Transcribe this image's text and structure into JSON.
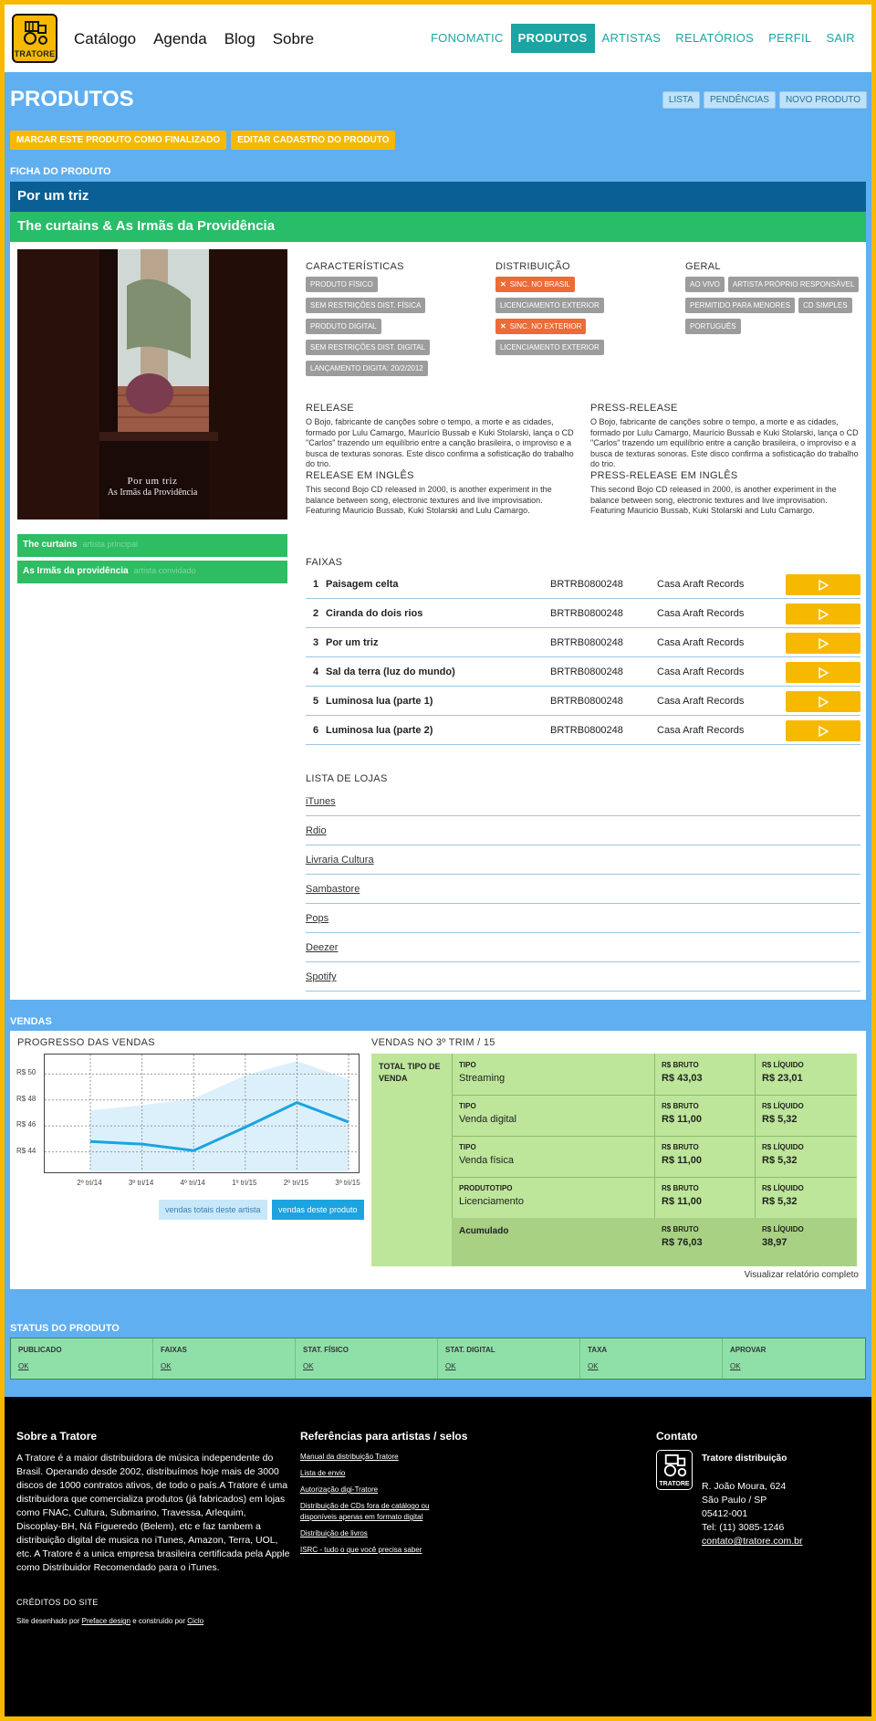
{
  "header": {
    "logo_text": "TRATORE",
    "main_nav": [
      "Catálogo",
      "Agenda",
      "Blog",
      "Sobre"
    ],
    "sub_nav": [
      "FONOMATIC",
      "PRODUTOS",
      "ARTISTAS",
      "RELATÓRIOS",
      "PERFIL",
      "SAIR"
    ],
    "active_sub_nav": "PRODUTOS"
  },
  "page": {
    "title": "PRODUTOS",
    "top_buttons": [
      "LISTA",
      "PENDÊNCIAS",
      "NOVO PRODUTO"
    ],
    "action_buttons": [
      "MARCAR ESTE PRODUTO COMO FINALIZADO",
      "EDITAR CADASTRO DO PRODUTO"
    ],
    "section_ficha": "FICHA DO PRODUTO"
  },
  "product": {
    "title": "Por um triz",
    "artist": "The curtains & As Irmãs da Providência",
    "cover_title": "Por um triz",
    "cover_subtitle": "As Irmãs da Providência",
    "artists": [
      {
        "name": "The curtains",
        "role": "artista principal"
      },
      {
        "name": "As Irmãs da providência",
        "role": "artista convidado"
      }
    ],
    "caracteristicas_title": "CARACTERÍSTICAS",
    "caracteristicas": [
      "PRODUTO FÍSICO",
      "SEM RESTRIÇÕES DIST. FÍSICA",
      "PRODUTO DIGITAL",
      "SEM RESTRIÇÕES DIST. DIGITAL",
      "LANÇAMENTO DIGITA: 20/2/2012"
    ],
    "distribuicao_title": "DISTRIBUIÇÃO",
    "distribuicao": [
      {
        "label": "SINC. NO BRASIL",
        "flag": "x"
      },
      {
        "label": "LICENCIAMENTO EXTERIOR",
        "flag": ""
      },
      {
        "label": "SINC. NO EXTERIOR",
        "flag": "x"
      },
      {
        "label": "LICENCIAMENTO EXTERIOR",
        "flag": ""
      }
    ],
    "geral_title": "GERAL",
    "geral": [
      "AO VIVO",
      "ARTISTA PRÓPRIO RESPONSÁVEL",
      "PERMITIDO PARA MENORES",
      "CD SIMPLES",
      "PORTUGUÊS"
    ],
    "release_title": "RELEASE",
    "release": "O Bojo, fabricante de canções sobre o tempo, a morte e as cidades, formado por Lulu Camargo, Maurício Bussab e Kuki Stolarski, lança o CD \"Carlos\" trazendo um equilíbrio entre a canção brasileira, o improviso e a busca de texturas sonoras. Este disco confirma a sofisticação do trabalho do trio.",
    "press_release_title": "PRESS-RELEASE",
    "press_release": "O Bojo, fabricante de canções sobre o tempo, a morte e as cidades, formado por Lulu Camargo, Maurício Bussab e Kuki Stolarski, lança o CD \"Carlos\" trazendo um equilíbrio entre a canção brasileira, o improviso e a busca de texturas sonoras. Este disco confirma a sofisticação do trabalho do trio.",
    "release_en_title": "RELEASE EM INGLÊS",
    "release_en": "This second Bojo CD released in 2000, is another experiment in the balance between song, electronic textures and live improvisation. Featuring Mauricio Bussab, Kuki Stolarski and Lulu Camargo.",
    "press_release_en_title": "PRESS-RELEASE EM INGLÊS",
    "press_release_en": "This second Bojo CD released in 2000, is another experiment in the balance between song, electronic textures and live improvisation. Featuring Mauricio Bussab, Kuki Stolarski and Lulu Camargo.",
    "faixas_title": "FAIXAS",
    "tracks": [
      {
        "num": "1",
        "title": "Paisagem celta",
        "isrc": "BRTRB0800248",
        "label": "Casa Araft Records"
      },
      {
        "num": "2",
        "title": "Ciranda do dois rios",
        "isrc": "BRTRB0800248",
        "label": "Casa Araft Records"
      },
      {
        "num": "3",
        "title": "Por um triz",
        "isrc": "BRTRB0800248",
        "label": "Casa Araft Records"
      },
      {
        "num": "4",
        "title": "Sal da terra (luz do mundo)",
        "isrc": "BRTRB0800248",
        "label": "Casa Araft Records"
      },
      {
        "num": "5",
        "title": "Luminosa lua (parte 1)",
        "isrc": "BRTRB0800248",
        "label": "Casa Araft Records"
      },
      {
        "num": "6",
        "title": "Luminosa lua (parte 2)",
        "isrc": "BRTRB0800248",
        "label": "Casa Araft Records"
      }
    ],
    "lojas_title": "LISTA DE LOJAS",
    "stores": [
      "iTunes",
      "Rdio",
      "Livraria Cultura",
      "Sambastore",
      "Pops",
      "Deezer",
      "Spotify"
    ]
  },
  "vendas": {
    "section_title": "VENDAS",
    "progress_title": "PROGRESSO DAS VENDAS",
    "legend_artist": "vendas totais deste artista",
    "legend_product": "vendas deste produto",
    "table_title": "VENDAS NO 3º TRIM / 15",
    "total_label": "TOTAL TIPO DE VENDA",
    "rows": [
      {
        "type_label": "TIPO",
        "type": "Streaming",
        "bruto": "R$ 43,03",
        "liquido": "R$ 23,01"
      },
      {
        "type_label": "TIPO",
        "type": "Venda digital",
        "bruto": "R$ 11,00",
        "liquido": "R$ 5,32"
      },
      {
        "type_label": "TIPO",
        "type": "Venda física",
        "bruto": "R$ 11,00",
        "liquido": "R$ 5,32"
      },
      {
        "type_label": "PRODUTOTIPO",
        "type": "Licenciamento",
        "bruto": "R$ 11,00",
        "liquido": "R$ 5,32"
      }
    ],
    "bruto_label": "R$ BRUTO",
    "liquido_label": "R$ LÍQUIDO",
    "acumulado_label": "Acumulado",
    "acumulado_bruto": "R$ 76,03",
    "acumulado_liquido": "38,97",
    "report_link": "Visualizar relatório completo"
  },
  "chart_data": {
    "type": "area",
    "categories": [
      "2º tri/14",
      "3º tri/14",
      "4º tri/14",
      "1º tri/15",
      "2º tri/15",
      "3º tri/15"
    ],
    "y_ticks": [
      "R$ 44",
      "R$ 46",
      "R$ 48",
      "R$ 50"
    ],
    "ylim": [
      42.5,
      51.5
    ],
    "series": [
      {
        "name": "vendas totais deste artista",
        "type": "area",
        "color": "#d8eefb",
        "values": [
          47.2,
          47.6,
          48.1,
          49.9,
          51.0,
          49.6
        ]
      },
      {
        "name": "vendas deste produto",
        "type": "line",
        "color": "#1ca3e0",
        "values": [
          44.8,
          44.6,
          44.1,
          45.9,
          47.8,
          46.3
        ]
      }
    ],
    "grid": true
  },
  "status": {
    "section_title": "STATUS DO PRODUTO",
    "columns": [
      {
        "label": "PUBLICADO",
        "value": "OK"
      },
      {
        "label": "FAIXAS",
        "value": "OK"
      },
      {
        "label": "STAT. FÍSICO",
        "value": "OK"
      },
      {
        "label": "STAT. DIGITAL",
        "value": "OK"
      },
      {
        "label": "TAXA",
        "value": "OK"
      },
      {
        "label": "APROVAR",
        "value": "OK"
      }
    ]
  },
  "footer": {
    "about_title": "Sobre a Tratore",
    "about_text": "A Tratore é a maior distribuidora de música independente do Brasil. Operando desde 2002, distribuímos hoje mais de 3000 discos de 1000 contratos ativos, de todo o país.A Tratore é uma distribuidora que comercializa produtos (já fabricados) em lojas como FNAC, Cultura, Submarino, Travessa, Arlequim, Discoplay-BH, Ná Figueredo (Belem), etc e faz tambem a distribuição digital de musica no iTunes, Amazon, Terra, UOL, etc. A Tratore é a unica empresa brasileira certificada pela Apple como Distribuidor Recomendado para o iTunes.",
    "refs_title": "Referências para artistas / selos",
    "refs": [
      "Manual da distribuição Tratore",
      "Lista de envio",
      "Autorização digi-Tratore",
      "Distribuição de CDs fora de catálogo ou disponíveis apenas em formato digital",
      "Distribuição de livros",
      "ISRC - tudo o que você precisa saber"
    ],
    "contact_title": "Contato",
    "contact_name": "Tratore distribuição",
    "contact_lines": [
      "R. João Moura, 624",
      "São Paulo / SP",
      "05412-001",
      "Tel: (11) 3085-1246"
    ],
    "contact_email": "contato@tratore.com.br",
    "logo_text": "TRATORE",
    "credits_title": "CRÉDITOS DO SITE",
    "credits_prefix": "Site desenhado por",
    "credits_designer": "Preface design",
    "credits_middle": "e construído por",
    "credits_builder": "Ciclo"
  }
}
